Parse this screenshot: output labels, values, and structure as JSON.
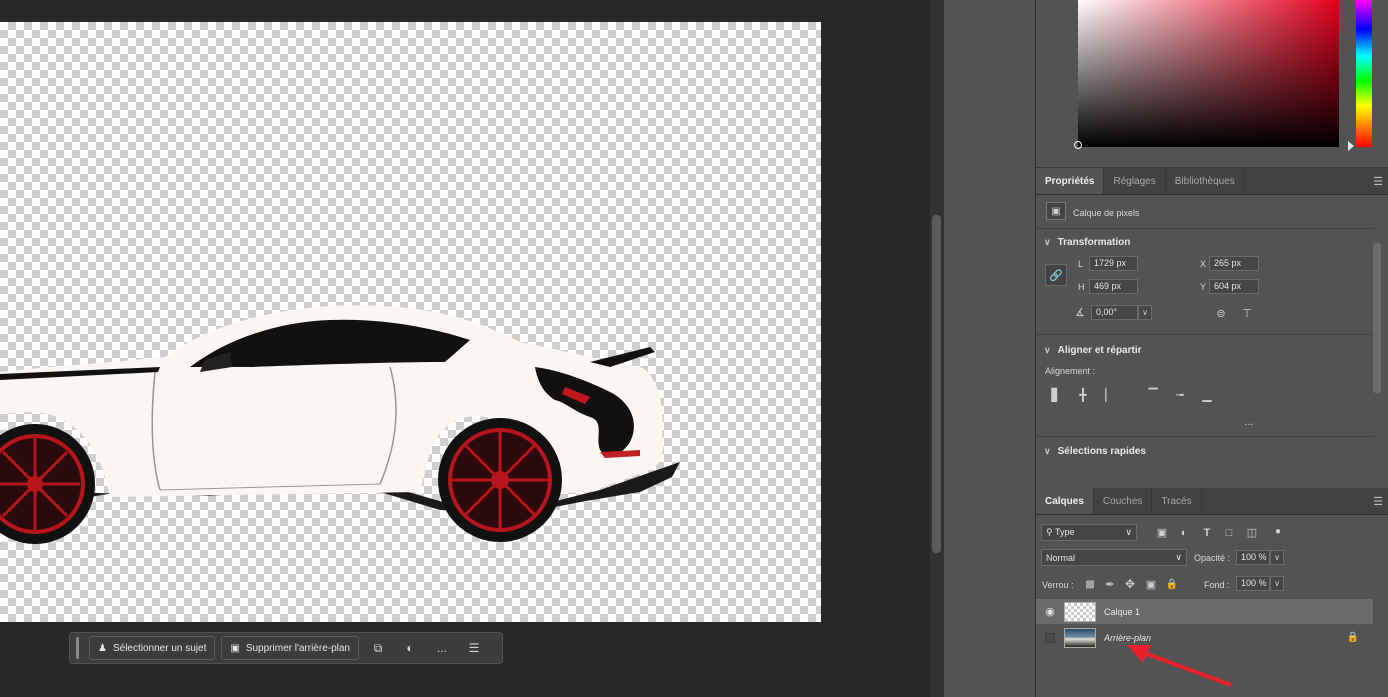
{
  "taskbar": {
    "select_subject": "Sélectionner un sujet",
    "remove_background": "Supprimer l'arrière-plan",
    "more": "..."
  },
  "properties_panel": {
    "tabs": [
      "Propriétés",
      "Réglages",
      "Bibliothèques"
    ],
    "active_tab": "Propriétés",
    "layer_kind": "Calque de pixels",
    "transform": {
      "title": "Transformation",
      "w_label": "L",
      "w_value": "1729 px",
      "h_label": "H",
      "h_value": "469 px",
      "x_label": "X",
      "x_value": "265 px",
      "y_label": "Y",
      "y_value": "604 px",
      "angle_value": "0,00°"
    },
    "align": {
      "title": "Aligner et répartir",
      "alignment_label": "Alignement :",
      "more": "..."
    },
    "quick_selections": {
      "title": "Sélections rapides"
    }
  },
  "layers_panel": {
    "tabs": [
      "Calques",
      "Couches",
      "Tracés"
    ],
    "active_tab": "Calques",
    "filter_type": "Type",
    "blend_mode": "Normal",
    "opacity_label": "Opacité :",
    "opacity_value": "100 %",
    "lock_label": "Verrou :",
    "fill_label": "Fond :",
    "fill_value": "100 %",
    "layers": [
      {
        "name": "Calque 1",
        "visible": true,
        "selected": true,
        "locked": false,
        "italic": false
      },
      {
        "name": "Arrière-plan",
        "visible": false,
        "selected": false,
        "locked": true,
        "italic": true
      }
    ]
  },
  "colors": {
    "accent_red": "#e8202a",
    "car_body": "#fbf6f1",
    "wheel_red": "#b8141c"
  }
}
